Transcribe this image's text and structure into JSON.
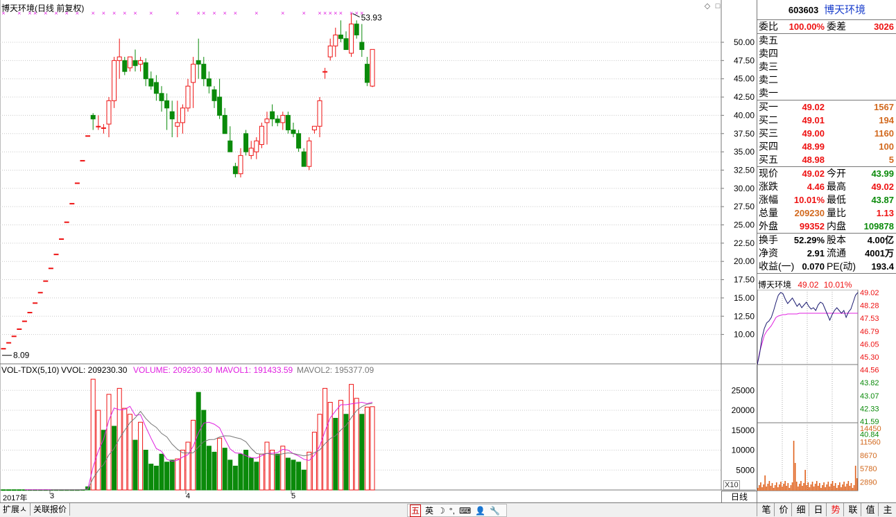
{
  "title": {
    "text": "博天环境(日线 前复权)",
    "window_icons": [
      "◇",
      "□"
    ]
  },
  "colors": {
    "up": "#e11",
    "down": "#0a8a0a",
    "ma1": "#e020e0",
    "ma2": "#777777",
    "marker": "#e020e0",
    "grid": "#c8c8c8"
  },
  "kline": {
    "y_ticks": [
      "50.00",
      "47.50",
      "45.00",
      "42.50",
      "40.00",
      "37.50",
      "35.00",
      "32.50",
      "30.00",
      "27.50",
      "25.00",
      "22.50",
      "20.00",
      "17.50",
      "15.00",
      "12.50",
      "10.00"
    ],
    "high_label": "53.93",
    "low_label": "8.09"
  },
  "volume": {
    "legend": {
      "name": "VOL-TDX(5,10)",
      "vvol": "VVOL: 209230.30",
      "volume": "VOLUME: 209230.30",
      "mavol1": "MAVOL1: 191433.59",
      "mavol2": "MAVOL2: 195377.09"
    },
    "y_ticks": [
      "25000",
      "20000",
      "15000",
      "10000",
      "5000"
    ],
    "unit_tag": "X10"
  },
  "date_axis": {
    "labels": [
      "2017年",
      "3",
      "4",
      "5"
    ]
  },
  "day_tab": "日线",
  "quote": {
    "code": "603603",
    "name": "博天环境",
    "weibi_label": "委比",
    "weibi": "100.00%",
    "weicha_label": "委差",
    "weicha": "3026",
    "asks": [
      "卖五",
      "卖四",
      "卖三",
      "卖二",
      "卖一"
    ],
    "bids": [
      {
        "label": "买一",
        "price": "49.02",
        "vol": "1567"
      },
      {
        "label": "买二",
        "price": "49.01",
        "vol": "194"
      },
      {
        "label": "买三",
        "price": "49.00",
        "vol": "1160"
      },
      {
        "label": "买四",
        "price": "48.99",
        "vol": "100"
      },
      {
        "label": "买五",
        "price": "48.98",
        "vol": "5"
      }
    ],
    "stats": [
      {
        "l1": "现价",
        "v1": "49.02",
        "c1": "red",
        "l2": "今开",
        "v2": "43.99",
        "c2": "green"
      },
      {
        "l1": "涨跌",
        "v1": "4.46",
        "c1": "red",
        "l2": "最高",
        "v2": "49.02",
        "c2": "red"
      },
      {
        "l1": "涨幅",
        "v1": "10.01%",
        "c1": "red",
        "l2": "最低",
        "v2": "43.87",
        "c2": "green"
      },
      {
        "l1": "总量",
        "v1": "209230",
        "c1": "orange",
        "l2": "量比",
        "v2": "1.13",
        "c2": "red"
      },
      {
        "l1": "外盘",
        "v1": "99352",
        "c1": "red",
        "l2": "内盘",
        "v2": "109878",
        "c2": "green"
      }
    ],
    "fin": [
      {
        "l1": "换手",
        "v1": "52.29%",
        "l2": "股本",
        "v2": "4.00亿"
      },
      {
        "l1": "净资",
        "v1": "2.91",
        "l2": "流通",
        "v2": "4001万"
      },
      {
        "l1": "收益(一)",
        "v1": "0.070",
        "l2": "PE(动)",
        "v2": "193.4"
      }
    ]
  },
  "mini_chart": {
    "name": "博天环境",
    "price": "49.02",
    "pct": "10.01%",
    "price_ticks": [
      "49.02",
      "48.28",
      "47.53",
      "46.79",
      "46.05",
      "45.30",
      "44.56",
      "43.82",
      "43.07",
      "42.33",
      "41.59",
      "40.84"
    ],
    "vol_ticks": [
      "14450",
      "11560",
      "8670",
      "5780",
      "2890"
    ]
  },
  "bottom_tabs": [
    "扩展ㅅ",
    "关联报价"
  ],
  "ime": [
    "五",
    "英",
    "☽",
    "°,",
    "⌨",
    "👤",
    "🔧"
  ],
  "right_tabs": [
    "笔",
    "价",
    "细",
    "日",
    "势",
    "联",
    "值",
    "主"
  ],
  "chart_data": {
    "type": "candlestick",
    "title": "博天环境(日线 前复权)",
    "ylim": [
      8.09,
      53.93
    ],
    "candles": [
      [
        8.09,
        8.09,
        8.09,
        8.09
      ],
      [
        8.9,
        8.9,
        8.9,
        8.9
      ],
      [
        9.79,
        9.79,
        9.79,
        9.79
      ],
      [
        10.77,
        10.77,
        10.77,
        10.77
      ],
      [
        11.85,
        11.85,
        11.85,
        11.85
      ],
      [
        13.04,
        13.04,
        13.04,
        13.04
      ],
      [
        14.34,
        14.34,
        14.34,
        14.34
      ],
      [
        15.77,
        15.77,
        15.77,
        15.77
      ],
      [
        17.35,
        17.35,
        17.35,
        17.35
      ],
      [
        19.09,
        19.09,
        19.09,
        19.09
      ],
      [
        21.0,
        21.0,
        21.0,
        21.0
      ],
      [
        23.1,
        23.1,
        23.1,
        23.1
      ],
      [
        25.41,
        25.41,
        25.41,
        25.41
      ],
      [
        27.95,
        27.95,
        27.95,
        27.95
      ],
      [
        30.75,
        30.75,
        30.75,
        30.75
      ],
      [
        33.83,
        33.83,
        33.83,
        33.83
      ],
      [
        37.21,
        37.21,
        37.21,
        37.21
      ],
      [
        40.0,
        40.3,
        38.0,
        39.5
      ],
      [
        38.5,
        40.0,
        38.0,
        38.5
      ],
      [
        38.2,
        38.8,
        37.5,
        38.3
      ],
      [
        38.8,
        42.5,
        37.0,
        42.0
      ],
      [
        42.0,
        48.0,
        41.0,
        47.5
      ],
      [
        47.5,
        50.5,
        45.0,
        48.0
      ],
      [
        47.5,
        48.0,
        45.5,
        46.0
      ],
      [
        46.5,
        48.0,
        46.0,
        48.0
      ],
      [
        47.5,
        49.0,
        46.0,
        46.8
      ],
      [
        47.0,
        48.0,
        46.0,
        47.5
      ],
      [
        47.2,
        47.8,
        44.0,
        45.0
      ],
      [
        45.0,
        46.0,
        43.5,
        44.0
      ],
      [
        44.5,
        45.5,
        42.0,
        43.0
      ],
      [
        43.0,
        44.0,
        40.5,
        42.0
      ],
      [
        42.0,
        43.0,
        38.0,
        41.0
      ],
      [
        40.5,
        42.0,
        37.0,
        39.5
      ],
      [
        38.5,
        42.0,
        37.0,
        39.0
      ],
      [
        39.0,
        41.5,
        37.5,
        41.0
      ],
      [
        41.0,
        45.0,
        40.5,
        44.0
      ],
      [
        44.5,
        48.0,
        41.0,
        47.0
      ],
      [
        47.5,
        50.5,
        45.0,
        47.0
      ],
      [
        47.0,
        48.0,
        44.0,
        45.0
      ],
      [
        45.0,
        46.0,
        43.0,
        44.0
      ],
      [
        43.5,
        44.0,
        41.0,
        42.0
      ],
      [
        42.5,
        45.0,
        39.5,
        40.0
      ],
      [
        40.0,
        41.0,
        37.5,
        37.5
      ],
      [
        36.5,
        38.5,
        35.0,
        35.0
      ],
      [
        33.0,
        33.5,
        31.5,
        32.0
      ],
      [
        32.0,
        35.5,
        31.5,
        34.5
      ],
      [
        37.5,
        38.0,
        34.5,
        35.0
      ],
      [
        34.5,
        36.5,
        34.0,
        35.5
      ],
      [
        35.0,
        37.0,
        34.0,
        36.5
      ],
      [
        36.0,
        39.0,
        35.5,
        38.5
      ],
      [
        39.0,
        40.5,
        36.0,
        39.5
      ],
      [
        40.5,
        41.5,
        38.5,
        39.5
      ],
      [
        39.5,
        40.0,
        38.5,
        39.0
      ],
      [
        39.0,
        40.5,
        38.0,
        40.0
      ],
      [
        40.0,
        40.5,
        37.5,
        38.0
      ],
      [
        38.0,
        39.0,
        37.0,
        37.5
      ],
      [
        37.5,
        38.0,
        35.0,
        35.5
      ],
      [
        35.0,
        35.5,
        33.0,
        33.0
      ],
      [
        33.0,
        37.0,
        32.5,
        36.5
      ],
      [
        38.0,
        38.5,
        37.5,
        38.5
      ],
      [
        38.5,
        42.5,
        37.0,
        42.0
      ],
      [
        46.0,
        46.5,
        45.0,
        46.0
      ],
      [
        48.0,
        50.5,
        47.5,
        49.5
      ],
      [
        49.5,
        52.0,
        48.0,
        51.0
      ],
      [
        51.0,
        53.0,
        50.0,
        50.5
      ],
      [
        50.5,
        51.5,
        49.0,
        49.0
      ],
      [
        48.5,
        53.93,
        48.0,
        52.5
      ],
      [
        52.5,
        53.0,
        50.5,
        51.0
      ],
      [
        50.0,
        52.5,
        48.0,
        49.0
      ],
      [
        47.0,
        48.0,
        44.0,
        44.5
      ],
      [
        44.0,
        49.02,
        43.87,
        49.02
      ]
    ],
    "volume": [
      [
        60,
        0
      ],
      [
        60,
        0
      ],
      [
        60,
        0
      ],
      [
        60,
        0
      ],
      [
        60,
        0
      ],
      [
        60,
        0
      ],
      [
        60,
        0
      ],
      [
        60,
        0
      ],
      [
        60,
        0
      ],
      [
        60,
        0
      ],
      [
        60,
        0
      ],
      [
        60,
        0
      ],
      [
        60,
        0
      ],
      [
        60,
        0
      ],
      [
        60,
        0
      ],
      [
        100,
        0
      ],
      [
        800,
        0
      ],
      [
        27800,
        1
      ],
      [
        20000,
        1
      ],
      [
        15000,
        0
      ],
      [
        24000,
        1
      ],
      [
        16000,
        0
      ],
      [
        25500,
        1
      ],
      [
        20500,
        1
      ],
      [
        19000,
        1
      ],
      [
        12500,
        0
      ],
      [
        17000,
        1
      ],
      [
        10000,
        0
      ],
      [
        6500,
        0
      ],
      [
        6000,
        0
      ],
      [
        9000,
        0
      ],
      [
        7000,
        0
      ],
      [
        7500,
        0
      ],
      [
        7800,
        1
      ],
      [
        10000,
        1
      ],
      [
        12000,
        1
      ],
      [
        17500,
        1
      ],
      [
        24500,
        0
      ],
      [
        20000,
        0
      ],
      [
        11000,
        0
      ],
      [
        9500,
        0
      ],
      [
        13000,
        1
      ],
      [
        10500,
        0
      ],
      [
        7500,
        0
      ],
      [
        6000,
        0
      ],
      [
        9000,
        0
      ],
      [
        10000,
        0
      ],
      [
        8000,
        0
      ],
      [
        7000,
        0
      ],
      [
        9000,
        1
      ],
      [
        12000,
        1
      ],
      [
        10000,
        1
      ],
      [
        9000,
        0
      ],
      [
        11000,
        1
      ],
      [
        8000,
        0
      ],
      [
        7500,
        0
      ],
      [
        7000,
        0
      ],
      [
        5000,
        0
      ],
      [
        9500,
        1
      ],
      [
        14500,
        1
      ],
      [
        19000,
        1
      ],
      [
        25500,
        1
      ],
      [
        22000,
        1
      ],
      [
        18000,
        0
      ],
      [
        22500,
        1
      ],
      [
        19000,
        0
      ],
      [
        26500,
        1
      ],
      [
        23000,
        1
      ],
      [
        19000,
        0
      ],
      [
        20800,
        1
      ],
      [
        20900,
        1
      ]
    ],
    "series": [
      {
        "name": "MAVOL1",
        "value": 191433.59
      },
      {
        "name": "MAVOL2",
        "value": 195377.09
      }
    ]
  }
}
